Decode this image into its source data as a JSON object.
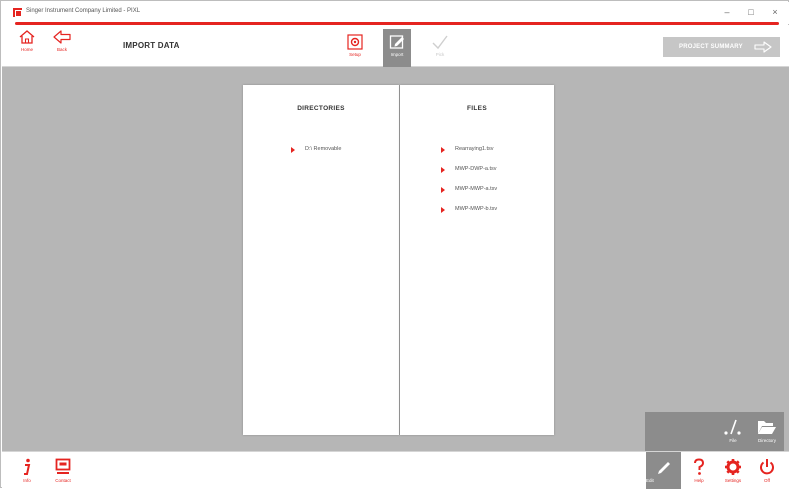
{
  "window": {
    "title": "Singer Instrument Company Limited - PIXL",
    "minimize_glyph": "–",
    "maximize_glyph": "□",
    "close_glyph": "×"
  },
  "toolbar": {
    "home_label": "Home",
    "back_label": "Back",
    "page_title": "IMPORT DATA",
    "stages": [
      {
        "label": "Setup",
        "icon": "gear-square-icon",
        "state": "normal"
      },
      {
        "label": "Import",
        "icon": "edit-document-icon",
        "state": "active"
      },
      {
        "label": "Pick",
        "icon": "checkmark-icon",
        "state": "disabled"
      }
    ],
    "project_summary_label": "PROJECT SUMMARY"
  },
  "directories": {
    "header": "DIRECTORIES",
    "items": [
      "D:\\ Removable"
    ]
  },
  "files": {
    "header": "FILES",
    "items": [
      "Rearraying1.tsv",
      "MWP-DWP-a.tsv",
      "MWP-MWP-a.tsv",
      "MWP-MWP-b.tsv"
    ]
  },
  "flyout": {
    "file_label": "File",
    "directory_label": "Directory"
  },
  "bottombar": {
    "info_label": "Info",
    "contact_label": "Contact",
    "edit_label": "Edit",
    "help_label": "Help",
    "settings_label": "Settings",
    "off_label": "Off"
  },
  "colors": {
    "accent": "#e52420",
    "workspace": "#b6b6b6",
    "active_tile": "#8c8c8c",
    "disabled": "#c6c6c6"
  }
}
